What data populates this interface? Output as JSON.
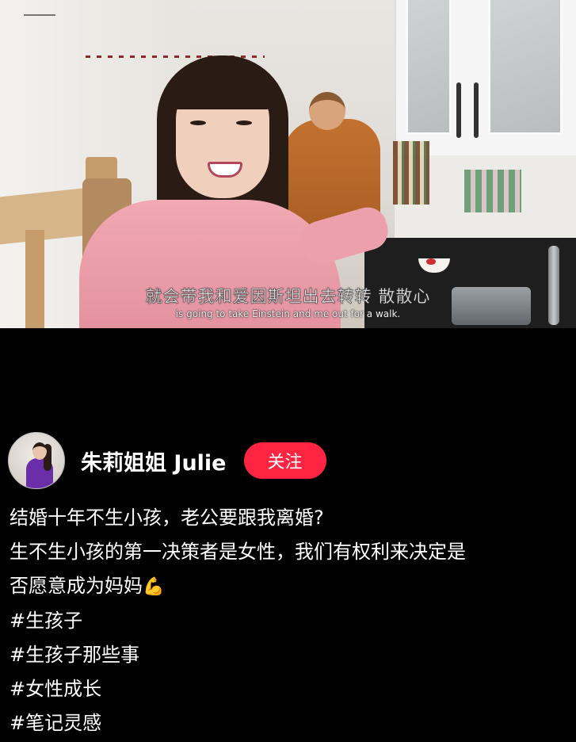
{
  "video": {
    "subtitle_cn": "就会带我和爱因斯坦出去转转  散散心",
    "subtitle_en": "is going to take Einstein and me out for a walk."
  },
  "author": {
    "name": "朱莉姐姐 Julie",
    "follow_label": "关注",
    "follow_color": "#ff2442"
  },
  "post": {
    "title": "结婚十年不生小孩，老公要跟我离婚?",
    "body_line1": "生不生小孩的第一决策者是女性，我们有权利来决定是",
    "body_line2": "否愿意成为妈妈",
    "emoji": "💪",
    "tags": [
      "#生孩子",
      "#生孩子那些事",
      "#女性成长",
      "#笔记灵感"
    ]
  }
}
